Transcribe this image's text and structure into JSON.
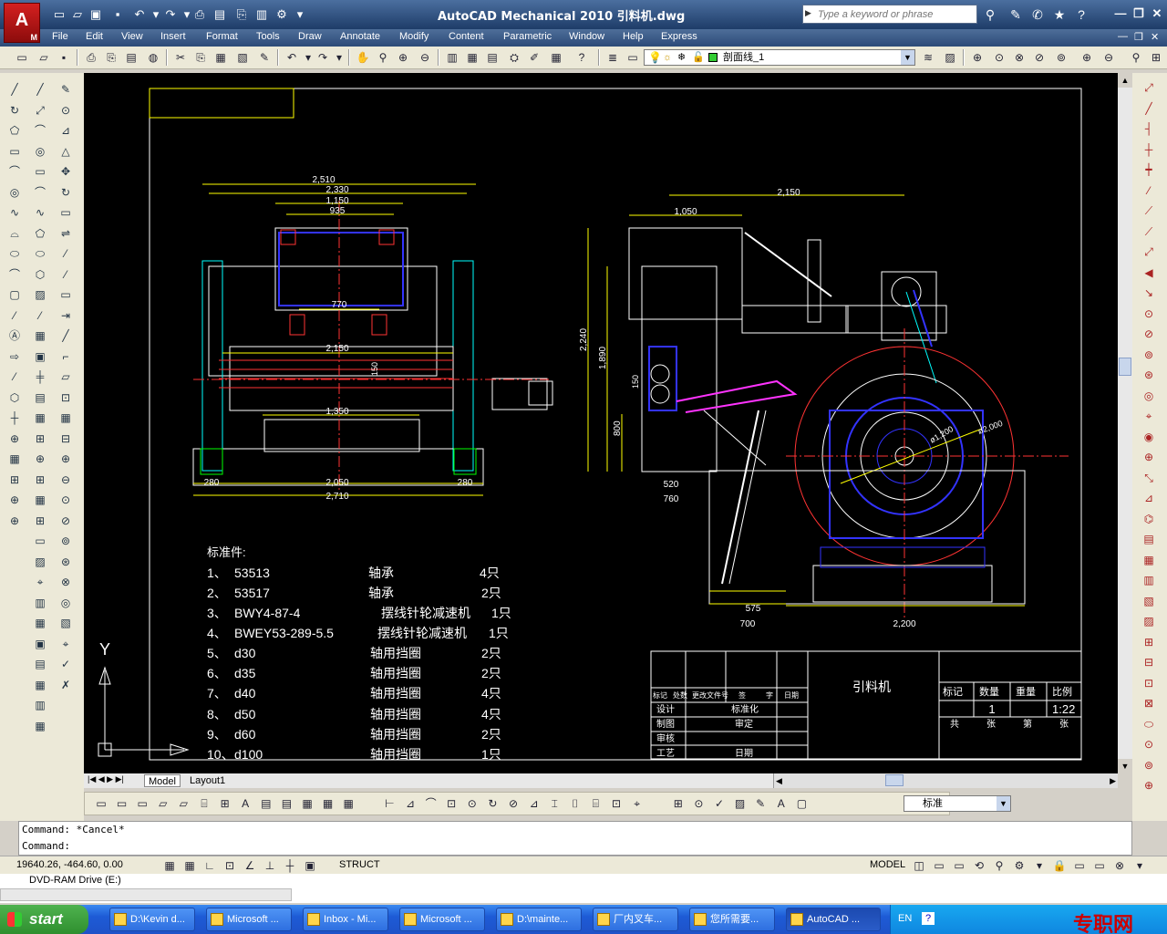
{
  "window": {
    "title": "AutoCAD Mechanical 2010    引料机.dwg",
    "search_placeholder": "Type a keyword or phrase",
    "logo_letter": "A",
    "logo_sub": "M"
  },
  "menu": [
    "File",
    "Edit",
    "View",
    "Insert",
    "Format",
    "Tools",
    "Draw",
    "Annotate",
    "Modify",
    "Content",
    "Parametric",
    "Window",
    "Help",
    "Express"
  ],
  "layer": {
    "current": "剖面线_1"
  },
  "dimstyle": {
    "current": "标准"
  },
  "tabs": {
    "model": "Model",
    "layout": "Layout1"
  },
  "drawing": {
    "dims_front": [
      "2,510",
      "2,330",
      "1,150",
      "935",
      "770",
      "2,150",
      "1,350",
      "280",
      "2,050",
      "280",
      "2,710",
      "150"
    ],
    "dims_side": [
      "2,150",
      "1,050",
      "2,240",
      "1,890",
      "800",
      "150",
      "520",
      "760",
      "575",
      "700",
      "2,200",
      "ø1,200",
      "ø2,000"
    ],
    "parts_heading": "标准件:",
    "parts": [
      {
        "no": "1、",
        "code": "53513",
        "name": "轴承",
        "qty": "4只"
      },
      {
        "no": "2、",
        "code": "53517",
        "name": "轴承",
        "qty": "2只"
      },
      {
        "no": "3、",
        "code": "BWY4-87-4",
        "name": "摆线针轮减速机",
        "qty": "1只"
      },
      {
        "no": "4、",
        "code": "BWEY53-289-5.5",
        "name": "摆线针轮减速机",
        "qty": "1只"
      },
      {
        "no": "5、",
        "code": "d30",
        "name": "轴用挡圈",
        "qty": "2只"
      },
      {
        "no": "6、",
        "code": "d35",
        "name": "轴用挡圈",
        "qty": "2只"
      },
      {
        "no": "7、",
        "code": "d40",
        "name": "轴用挡圈",
        "qty": "4只"
      },
      {
        "no": "8、",
        "code": "d50",
        "name": "轴用挡圈",
        "qty": "4只"
      },
      {
        "no": "9、",
        "code": "d60",
        "name": "轴用挡圈",
        "qty": "2只"
      },
      {
        "no": "10、",
        "code": "d100",
        "name": "轴用挡圈",
        "qty": "1只"
      }
    ],
    "title_block": {
      "name": "引料机",
      "headers": [
        "标记",
        "数量",
        "重量",
        "比例"
      ],
      "qty": "1",
      "scale": "1:22",
      "sheet_row": [
        "共",
        "张",
        "第",
        "张"
      ],
      "rev_header": [
        "标记",
        "处数",
        "更改文件号",
        "签",
        "字",
        "日期"
      ],
      "roles": [
        "设计",
        "制图",
        "审核",
        "工艺"
      ],
      "roles2": [
        "标准化",
        "审定",
        "",
        "日期"
      ]
    },
    "ucs_y": "Y"
  },
  "command": {
    "line1": "Command: *Cancel*",
    "line2": "Command:"
  },
  "status": {
    "coords": "19640.26, -464.60, 0.00",
    "struct": "STRUCT",
    "model": "MODEL"
  },
  "explorer": {
    "item": "DVD-RAM Drive (E:)"
  },
  "taskbar": {
    "start": "start",
    "items": [
      "D:\\Kevin d...",
      "Microsoft ...",
      "Inbox - Mi...",
      "Microsoft ...",
      "D:\\mainte...",
      "厂内叉车...",
      "您所需要...",
      "AutoCAD ..."
    ],
    "lang": "EN",
    "watermark": "专职网"
  }
}
